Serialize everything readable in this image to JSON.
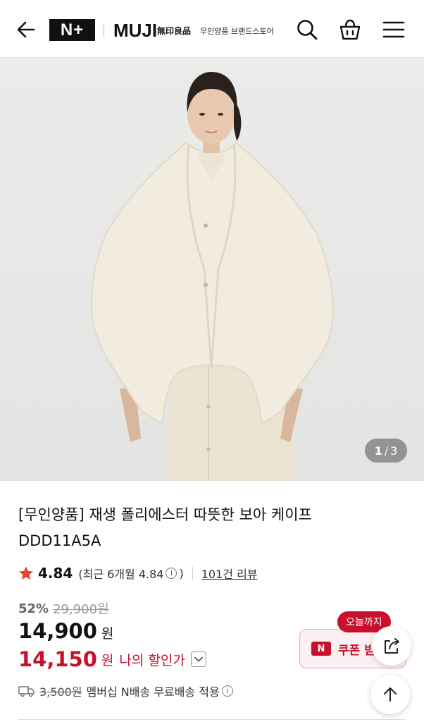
{
  "header": {
    "brand_plus": "N+",
    "brand_muji": "MUJI",
    "brand_kanji": "無印良品",
    "store_name": "무인양품 브랜드스토어",
    "icons": [
      "back-arrow-icon",
      "search-icon",
      "shopping-bag-icon",
      "menu-icon"
    ]
  },
  "gallery": {
    "current": "1",
    "separator": "/",
    "total": "3"
  },
  "product": {
    "title_line1": "[무인양품] 재생 폴리에스터 따뜻한 보아 케이프",
    "title_line2": "DDD11A5A"
  },
  "rating": {
    "score": "4.84",
    "recent_prefix": "(최근 6개월 4.84",
    "recent_suffix": ")",
    "reviews": "101건 리뷰"
  },
  "price": {
    "discount_rate": "52%",
    "original": "29,900원",
    "sale": "14,900",
    "won": "원",
    "my_price": "14,150",
    "my_won": "원",
    "my_label": "나의 할인가"
  },
  "shipping": {
    "original_fee": "3,500원",
    "text": "멤버십 N배송 무료배송 적용"
  },
  "coupon": {
    "badge": "오늘까지",
    "n_mark": "N",
    "label": "쿠폰 받"
  },
  "colors": {
    "accent": "#c8102e",
    "star": "#e8412c"
  }
}
